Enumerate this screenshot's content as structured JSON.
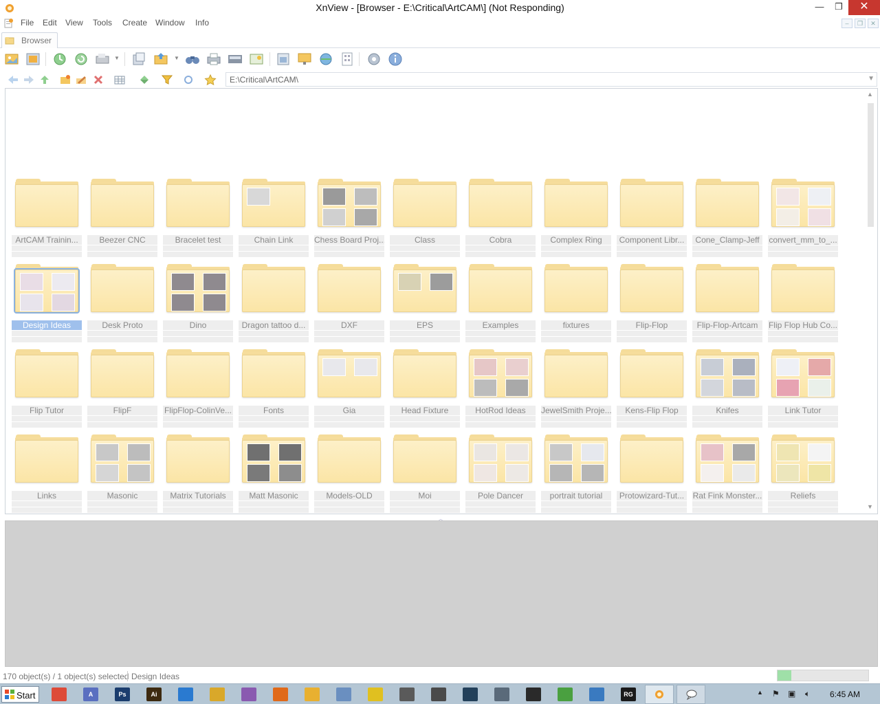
{
  "window": {
    "title": "XnView - [Browser - E:\\Critical\\ArtCAM\\] (Not Responding)",
    "min_glyph": "—",
    "max_glyph": "❐",
    "close_glyph": "✕"
  },
  "menu": [
    "File",
    "Edit",
    "View",
    "Tools",
    "Create",
    "Window",
    "Info"
  ],
  "tabs": [
    {
      "label": "Browser"
    }
  ],
  "address": {
    "path": "E:\\Critical\\ArtCAM\\"
  },
  "folders": [
    {
      "name": "ArtCAM Trainin...",
      "thumbs": []
    },
    {
      "name": "Beezer CNC",
      "thumbs": []
    },
    {
      "name": "Bracelet test",
      "thumbs": []
    },
    {
      "name": "Chain Link",
      "thumbs": [
        "#d8d8d8"
      ]
    },
    {
      "name": "Chess Board Proj...",
      "thumbs": [
        "#9a9a9a",
        "#bdbdbd",
        "#d0d0d0",
        "#a8a8a8"
      ]
    },
    {
      "name": "Class",
      "thumbs": []
    },
    {
      "name": "Cobra",
      "thumbs": []
    },
    {
      "name": "Complex Ring",
      "thumbs": []
    },
    {
      "name": "Component Libr...",
      "thumbs": []
    },
    {
      "name": "Cone_Clamp-Jeff",
      "thumbs": []
    },
    {
      "name": "convert_mm_to_...",
      "thumbs": [
        "#f2e6e6",
        "#eef0f4",
        "#f3eee6",
        "#f0e0e4"
      ]
    },
    {
      "name": "Design Ideas",
      "thumbs": [
        "#e9dde6",
        "#eceaf0",
        "#e8e4ec",
        "#e3d8e2"
      ],
      "selected": true
    },
    {
      "name": "Desk Proto",
      "thumbs": []
    },
    {
      "name": "Dino",
      "thumbs": [
        "#8f8a8f",
        "#8f8a8f",
        "#8f8a8f",
        "#8f8a8f"
      ]
    },
    {
      "name": "Dragon tattoo d...",
      "thumbs": []
    },
    {
      "name": "DXF",
      "thumbs": []
    },
    {
      "name": "EPS",
      "thumbs": [
        "#d8d2b4",
        "#9c9c9c"
      ]
    },
    {
      "name": "Examples",
      "thumbs": []
    },
    {
      "name": "fixtures",
      "thumbs": []
    },
    {
      "name": "Flip-Flop",
      "thumbs": []
    },
    {
      "name": "Flip-Flop-Artcam",
      "thumbs": []
    },
    {
      "name": "Flip Flop Hub Co...",
      "thumbs": []
    },
    {
      "name": "Flip Tutor",
      "thumbs": []
    },
    {
      "name": "FlipF",
      "thumbs": []
    },
    {
      "name": "FlipFlop-ColinVe...",
      "thumbs": []
    },
    {
      "name": "Fonts",
      "thumbs": []
    },
    {
      "name": "Gia",
      "thumbs": [
        "#e8e8ec",
        "#e8e8ec"
      ]
    },
    {
      "name": "Head Fixture",
      "thumbs": []
    },
    {
      "name": "HotRod Ideas",
      "thumbs": [
        "#e6c7c7",
        "#e9cfcf",
        "#bcbcbc",
        "#a9a9a9"
      ]
    },
    {
      "name": "JewelSmith Proje...",
      "thumbs": []
    },
    {
      "name": "Kens-Flip Flop",
      "thumbs": []
    },
    {
      "name": "Knifes",
      "thumbs": [
        "#c8cdd6",
        "#aab0bd",
        "#d3d6dc",
        "#b8bcc6"
      ]
    },
    {
      "name": "Link Tutor",
      "thumbs": [
        "#eef0f6",
        "#e5a9a9",
        "#e7a3b2",
        "#eaf0ea"
      ]
    },
    {
      "name": "Links",
      "thumbs": []
    },
    {
      "name": "Masonic",
      "thumbs": [
        "#c8c8c8",
        "#bcbcbc",
        "#d6d6d6",
        "#c4c4c4"
      ]
    },
    {
      "name": "Matrix Tutorials",
      "thumbs": []
    },
    {
      "name": "Matt Masonic",
      "thumbs": [
        "#707070",
        "#707070",
        "#7a7a7a",
        "#8d8d8d"
      ]
    },
    {
      "name": "Models-OLD",
      "thumbs": []
    },
    {
      "name": "Moi",
      "thumbs": []
    },
    {
      "name": "Pole Dancer",
      "thumbs": [
        "#eae6e2",
        "#ebe7e4",
        "#efe7e3",
        "#ede9e5"
      ]
    },
    {
      "name": "portrait tutorial",
      "thumbs": [
        "#c8c8c8",
        "#e6e8ee",
        "#b6b6b6",
        "#b6b6b6"
      ]
    },
    {
      "name": "Protowizard-Tut...",
      "thumbs": []
    },
    {
      "name": "Rat Fink Monster...",
      "thumbs": [
        "#e7c2c8",
        "#a8a8a8",
        "#f4f0ee",
        "#eaeaea"
      ]
    },
    {
      "name": "Reliefs",
      "thumbs": [
        "#efe5b2",
        "#f4f4f4",
        "#ece6bc",
        "#efe5a6"
      ]
    }
  ],
  "status": {
    "objects": "170 object(s) / 1 object(s) selected",
    "current": "Design Ideas",
    "progress": 0.15
  },
  "taskbar": {
    "start_label": "Start",
    "clock": "6:45 AM",
    "apps": [
      {
        "name": "chrome-icon",
        "color": "#dd4b39",
        "text": ""
      },
      {
        "name": "artcam-icon",
        "color": "#5a6fc0",
        "text": "A"
      },
      {
        "name": "photoshop-icon",
        "color": "#1b3d6e",
        "text": "Ps"
      },
      {
        "name": "illustrator-icon",
        "color": "#3d2a10",
        "text": "Ai"
      },
      {
        "name": "app-blue-icon",
        "color": "#2a7ad0",
        "text": ""
      },
      {
        "name": "app-yellow-icon",
        "color": "#d9a82a",
        "text": ""
      },
      {
        "name": "app-purple-icon",
        "color": "#8a5ab0",
        "text": ""
      },
      {
        "name": "firefox-icon",
        "color": "#e06a1a",
        "text": ""
      },
      {
        "name": "paint-icon",
        "color": "#e8b030",
        "text": ""
      },
      {
        "name": "calculator-icon",
        "color": "#6a8fc0",
        "text": ""
      },
      {
        "name": "disc-icon",
        "color": "#e0c020",
        "text": ""
      },
      {
        "name": "scanner-icon",
        "color": "#5a5a5a",
        "text": ""
      },
      {
        "name": "printer-icon",
        "color": "#4a4a4a",
        "text": ""
      },
      {
        "name": "steam-icon",
        "color": "#23405a",
        "text": ""
      },
      {
        "name": "pin-icon",
        "color": "#5a6a7a",
        "text": ""
      },
      {
        "name": "terminal-icon",
        "color": "#2a2a2a",
        "text": ""
      },
      {
        "name": "app-green-icon",
        "color": "#4aa040",
        "text": ""
      },
      {
        "name": "screen-icon",
        "color": "#3a7ac0",
        "text": ""
      },
      {
        "name": "rg-icon",
        "color": "#1a1a1a",
        "text": "RG"
      }
    ]
  }
}
